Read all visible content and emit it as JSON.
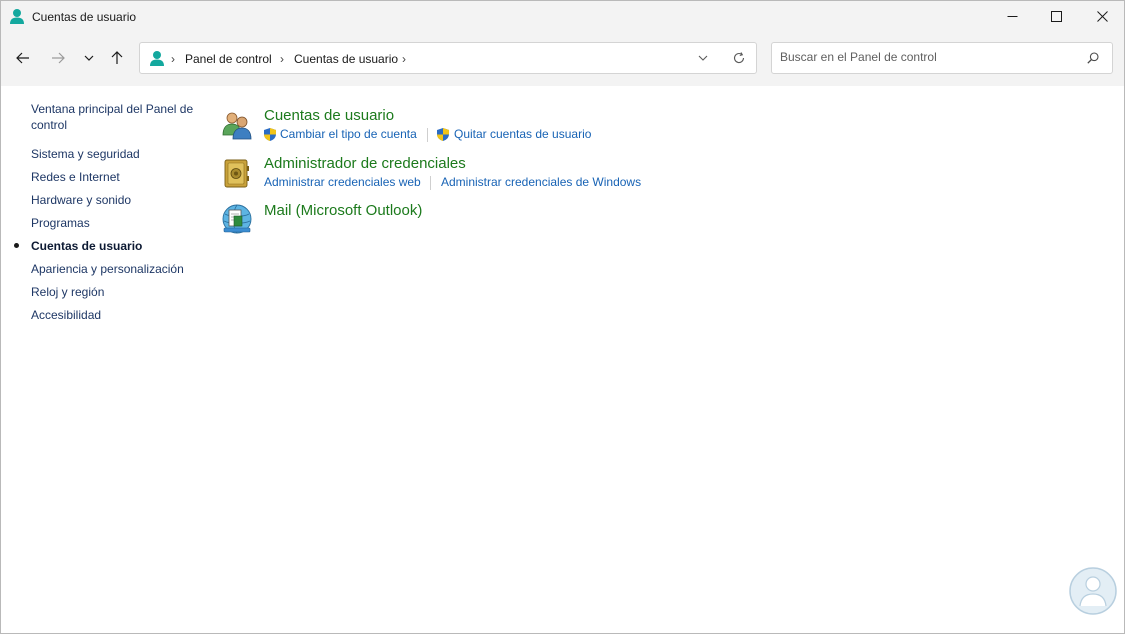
{
  "window": {
    "title": "Cuentas de usuario"
  },
  "address_bar": {
    "breadcrumbs": [
      "Panel de control",
      "Cuentas de usuario"
    ]
  },
  "search": {
    "placeholder": "Buscar en el Panel de control"
  },
  "left_nav": {
    "items": [
      {
        "label": "Ventana principal del Panel de control",
        "active": false
      },
      {
        "label": "Sistema y seguridad",
        "active": false
      },
      {
        "label": "Redes e Internet",
        "active": false
      },
      {
        "label": "Hardware y sonido",
        "active": false
      },
      {
        "label": "Programas",
        "active": false
      },
      {
        "label": "Cuentas de usuario",
        "active": true
      },
      {
        "label": "Apariencia y personalización",
        "active": false
      },
      {
        "label": "Reloj y región",
        "active": false
      },
      {
        "label": "Accesibilidad",
        "active": false
      }
    ]
  },
  "categories": [
    {
      "title": "Cuentas de usuario",
      "icon": "users-icon",
      "links": [
        "Cambiar el tipo de cuenta",
        "Quitar cuentas de usuario"
      ]
    },
    {
      "title": "Administrador de credenciales",
      "icon": "credential-vault-icon",
      "links": [
        "Administrar credenciales web",
        "Administrar credenciales de Windows"
      ]
    },
    {
      "title": "Mail (Microsoft Outlook)",
      "icon": "mail-icon",
      "links": []
    }
  ],
  "colors": {
    "category_title": "#1c7a1c",
    "link": "#1863b5",
    "chrome": "#f3f3f3",
    "accent_teal": "#13a89e"
  }
}
